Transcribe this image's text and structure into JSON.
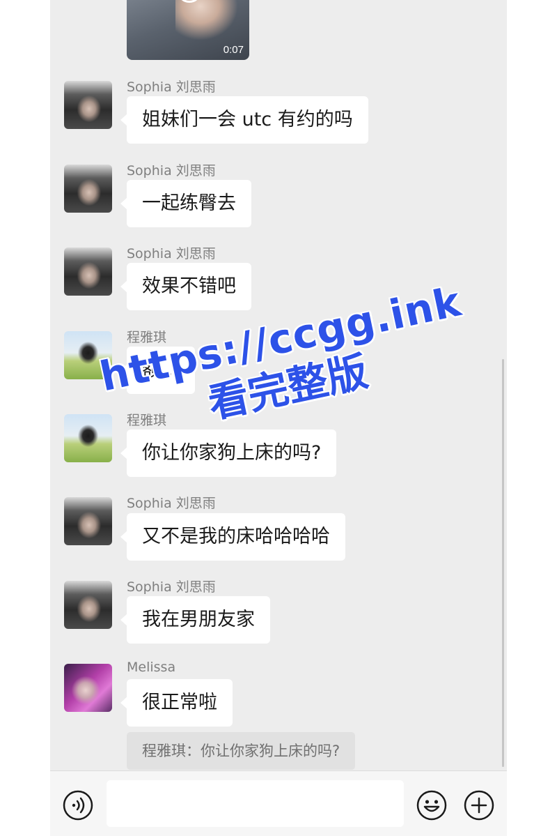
{
  "chat": {
    "video": {
      "duration": "0:07"
    },
    "messages": [
      {
        "sender": "Sophia 刘思雨",
        "text": "姐妹们一会 utc 有约的吗",
        "avatar": "gym-photo-avatar"
      },
      {
        "sender": "Sophia 刘思雨",
        "text": "一起练臀去",
        "avatar": "gym-photo-avatar"
      },
      {
        "sender": "Sophia 刘思雨",
        "text": "效果不错吧",
        "avatar": "gym-photo-avatar"
      },
      {
        "sender": "程雅琪",
        "text": "额…",
        "avatar": "field-photo-avatar"
      },
      {
        "sender": "程雅琪",
        "text": "你让你家狗上床的吗?",
        "avatar": "field-photo-avatar"
      },
      {
        "sender": "Sophia 刘思雨",
        "text": "又不是我的床哈哈哈哈",
        "avatar": "gym-photo-avatar"
      },
      {
        "sender": "Sophia 刘思雨",
        "text": "我在男朋友家",
        "avatar": "gym-photo-avatar"
      },
      {
        "sender": "Melissa",
        "text": "很正常啦",
        "avatar": "pink-photo-avatar"
      }
    ],
    "quote": "程雅琪：你让你家狗上床的吗?"
  },
  "watermark": {
    "line1": "https://ccgg.ink",
    "line2": "看完整版"
  },
  "input_bar": {
    "icons": {
      "voice": "voice-icon",
      "emoji": "emoji-icon",
      "plus": "plus-icon"
    },
    "text_value": ""
  },
  "colors": {
    "background": "#ededed",
    "bubble": "#ffffff",
    "watermark": "#2d52e8",
    "sender": "#7f7f7f"
  }
}
